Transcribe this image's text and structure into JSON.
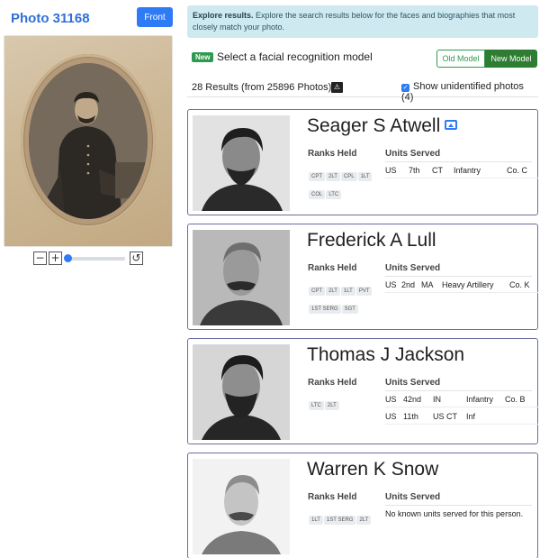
{
  "left": {
    "title": "Photo 31168",
    "front_label": "Front",
    "zoom_minus": "−",
    "zoom_plus": "+",
    "reset_icon": "↺"
  },
  "alert": {
    "bold": "Explore results.",
    "text": " Explore the search results below for the faces and biographies that most closely match your photo."
  },
  "model": {
    "badge": "New",
    "label": "Select a facial recognition model",
    "old_label": "Old Model",
    "new_label": "New Model"
  },
  "results": {
    "count": "28 Results (from 25896 Photos)",
    "icon": "⚠",
    "checkbox_mark": "✓",
    "show_unidentified": "Show unidentified photos (4)"
  },
  "headers": {
    "ranks": "Ranks Held",
    "units": "Units Served"
  },
  "cards": [
    {
      "name": "Seager S Atwell",
      "ranks": [
        "CPT",
        "2LT",
        "CPL",
        "1LT",
        "COL",
        "LTC"
      ],
      "units": [
        [
          "US",
          "7th",
          "CT",
          "Infantry",
          "Co. C"
        ]
      ],
      "no_units": ""
    },
    {
      "name": "Frederick A Lull",
      "ranks": [
        "CPT",
        "2LT",
        "1LT",
        "PVT",
        "1ST SERG",
        "SGT"
      ],
      "units": [
        [
          "US",
          "2nd",
          "MA",
          "Heavy Artillery",
          "Co. K"
        ]
      ],
      "no_units": ""
    },
    {
      "name": "Thomas J Jackson",
      "ranks": [
        "LTC",
        "2LT"
      ],
      "units": [
        [
          "US",
          "42nd",
          "IN",
          "Infantry",
          "Co. B"
        ],
        [
          "US",
          "11th",
          "US CT",
          "Inf",
          ""
        ]
      ],
      "no_units": ""
    },
    {
      "name": "Warren K Snow",
      "ranks": [
        "1LT",
        "1ST SERG",
        "2LT"
      ],
      "units": [],
      "no_units": "No known units served for this person."
    }
  ],
  "colors": {
    "accent": "#2f7bf5",
    "green": "#2e7d32",
    "alert_bg": "#cfe9f1",
    "card_border": "#6b6ea0"
  }
}
